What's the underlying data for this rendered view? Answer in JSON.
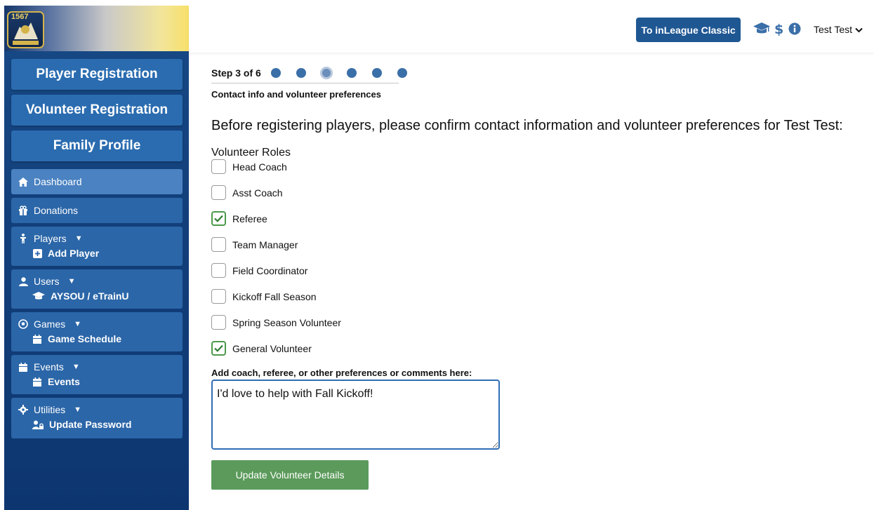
{
  "sidebar": {
    "logo_text": "1567",
    "big_buttons": [
      "Player Registration",
      "Volunteer Registration",
      "Family Profile"
    ],
    "nav": {
      "dashboard": "Dashboard",
      "donations": "Donations",
      "players": "Players",
      "add_player": "Add Player",
      "users": "Users",
      "aysou": "AYSOU / eTrainU",
      "games": "Games",
      "game_schedule": "Game Schedule",
      "events": "Events",
      "events_sub": "Events",
      "utilities": "Utilities",
      "update_password": "Update Password",
      "caret": "▼"
    }
  },
  "topbar": {
    "classic_button": "To inLeague Classic",
    "user_name": "Test Test"
  },
  "wizard": {
    "step_label": "Step 3 of 6",
    "total_steps": 6,
    "current_step": 3,
    "description": "Contact info and volunteer preferences"
  },
  "main": {
    "intro": "Before registering players, please confirm contact information and volunteer preferences for Test Test:",
    "roles_title": "Volunteer Roles",
    "roles": [
      {
        "label": "Head Coach",
        "checked": false
      },
      {
        "label": "Asst Coach",
        "checked": false
      },
      {
        "label": "Referee",
        "checked": true
      },
      {
        "label": "Team Manager",
        "checked": false
      },
      {
        "label": "Field Coordinator",
        "checked": false
      },
      {
        "label": "Kickoff Fall Season",
        "checked": false
      },
      {
        "label": "Spring Season Volunteer",
        "checked": false
      },
      {
        "label": "General Volunteer",
        "checked": true
      }
    ],
    "comments_label": "Add coach, referee, or other preferences or comments here:",
    "comments_value": "I'd love to help with Fall Kickoff!",
    "update_button": "Update Volunteer Details"
  },
  "colors": {
    "sidebar_bg": "#123f7a",
    "button_blue": "#2b6cb0",
    "classic_button": "#1f5793",
    "check_green": "#4a9a4a",
    "update_button": "#5b9a5b"
  }
}
